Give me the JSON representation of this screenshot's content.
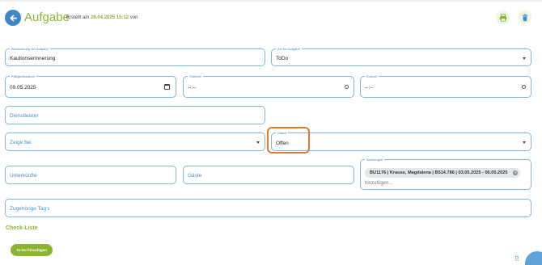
{
  "header": {
    "title": "Aufgabe",
    "created_prefix": "Erstellt am",
    "created_datetime": "26.04.2025 15:12",
    "created_suffix": "von"
  },
  "form": {
    "bezeichnung": {
      "label": "Bezeichnung der Aufgabe",
      "value": "Kautionserinnerung"
    },
    "art": {
      "label": "Art der Aufgabe",
      "value": "ToDo"
    },
    "faelligkeit": {
      "label": "Fälligkeitsdatum",
      "value": "09.05.2025"
    },
    "startzeit": {
      "label": "Startzeit",
      "value": "--:--"
    },
    "endzeit": {
      "label": "Endzeit",
      "value": "--:--"
    },
    "dienstleister": {
      "placeholder": "Dienstleister"
    },
    "zeige_bei": {
      "placeholder": "Zeige bei"
    },
    "status": {
      "label": "Status",
      "value": "Offen"
    },
    "unterkuenfte": {
      "placeholder": "Unterkünfte"
    },
    "gaeste": {
      "placeholder": "Gäste"
    },
    "buchungen": {
      "label": "Buchungen",
      "chip": "BU1176 | Krause, Magdalena | B514.786 | 03.05.2025 - 06.05.2025",
      "add_placeholder": "hinzufügen..."
    },
    "tags": {
      "placeholder": "Zugehörige Tag's"
    }
  },
  "checklist": {
    "title": "Check-Liste",
    "add_button": "To-Do hinzufügen"
  },
  "colors": {
    "accent_green": "#8ab52e",
    "accent_blue": "#3f86c6",
    "highlight_orange": "#e07a2a"
  },
  "icons": {
    "back": "back-arrow-icon",
    "print": "printer-icon",
    "delete": "trash-icon",
    "calendar": "calendar-icon",
    "clock": "clock-icon",
    "remove_chip": "close-circle-icon",
    "grip": "grip-dots-icon"
  }
}
